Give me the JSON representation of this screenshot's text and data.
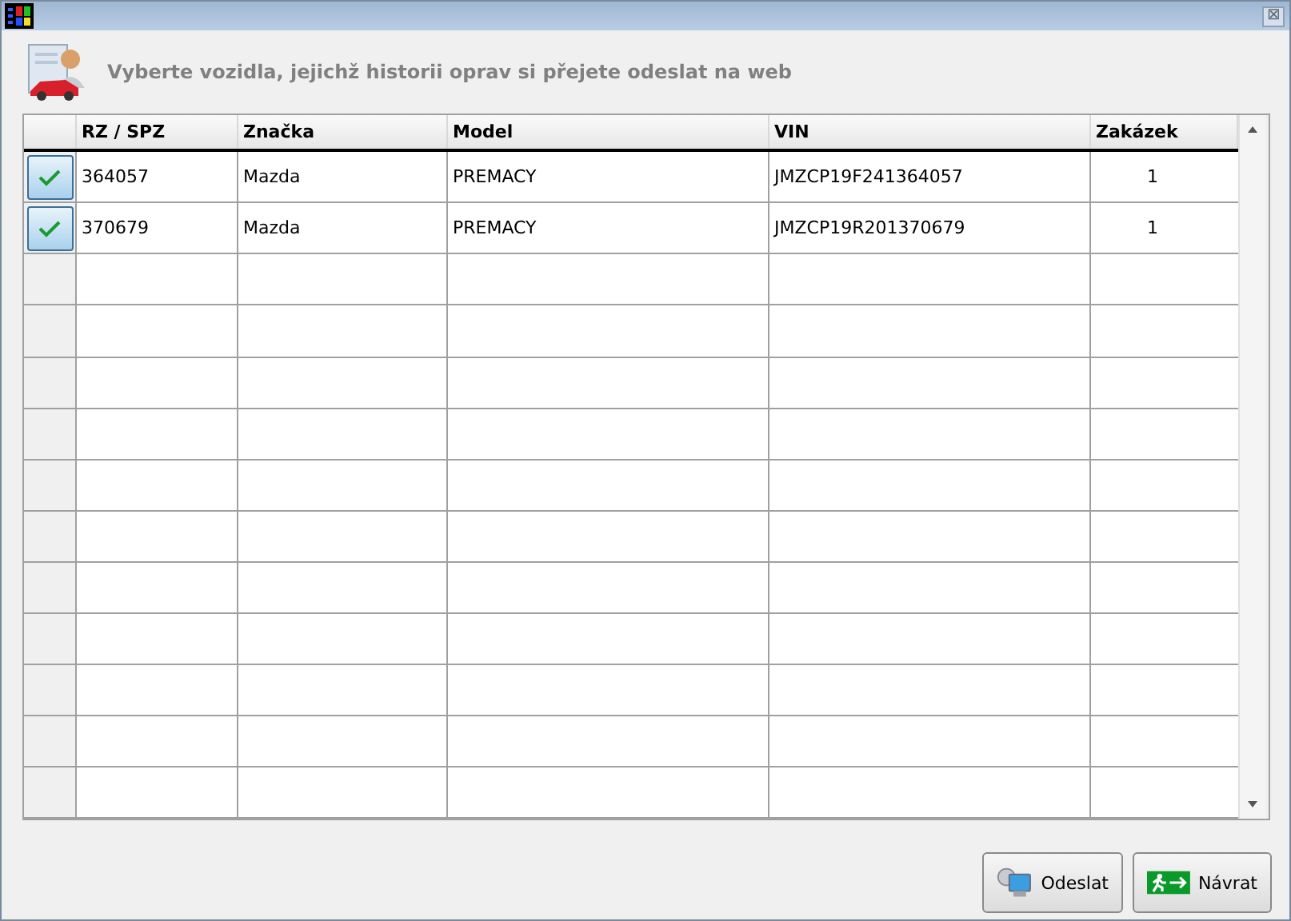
{
  "window": {
    "close_label": "⊠"
  },
  "heading": "Vyberte vozidla, jejichž historii oprav si přejete odeslat na web",
  "table": {
    "columns": [
      "RZ / SPZ",
      "Značka",
      "Model",
      "VIN",
      "Zakázek"
    ],
    "rows": [
      {
        "checked": true,
        "cells": [
          "364057",
          "Mazda",
          "PREMACY",
          "JMZCP19F241364057",
          "1"
        ]
      },
      {
        "checked": true,
        "cells": [
          "370679",
          "Mazda",
          "PREMACY",
          "JMZCP19R201370679",
          "1"
        ]
      }
    ]
  },
  "buttons": [
    {
      "kind": "send",
      "label": "Odeslat"
    },
    {
      "kind": "exit",
      "label": "Návrat"
    }
  ]
}
